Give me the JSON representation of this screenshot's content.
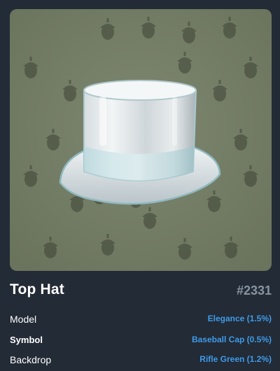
{
  "gift": {
    "name": "Top Hat",
    "number": "#2331",
    "pattern_icon": "acorn-icon",
    "colors": {
      "backdrop": "#778068",
      "pattern": "#3d4435",
      "page_bg": "#232b36",
      "link": "#3f9ae8"
    }
  },
  "attributes": [
    {
      "label": "Model",
      "value": "Elegance (1.5%)"
    },
    {
      "label": "Symbol",
      "value": "Baseball Cap (0.5%)"
    },
    {
      "label": "Backdrop",
      "value": "Rifle Green (1.2%)"
    }
  ]
}
